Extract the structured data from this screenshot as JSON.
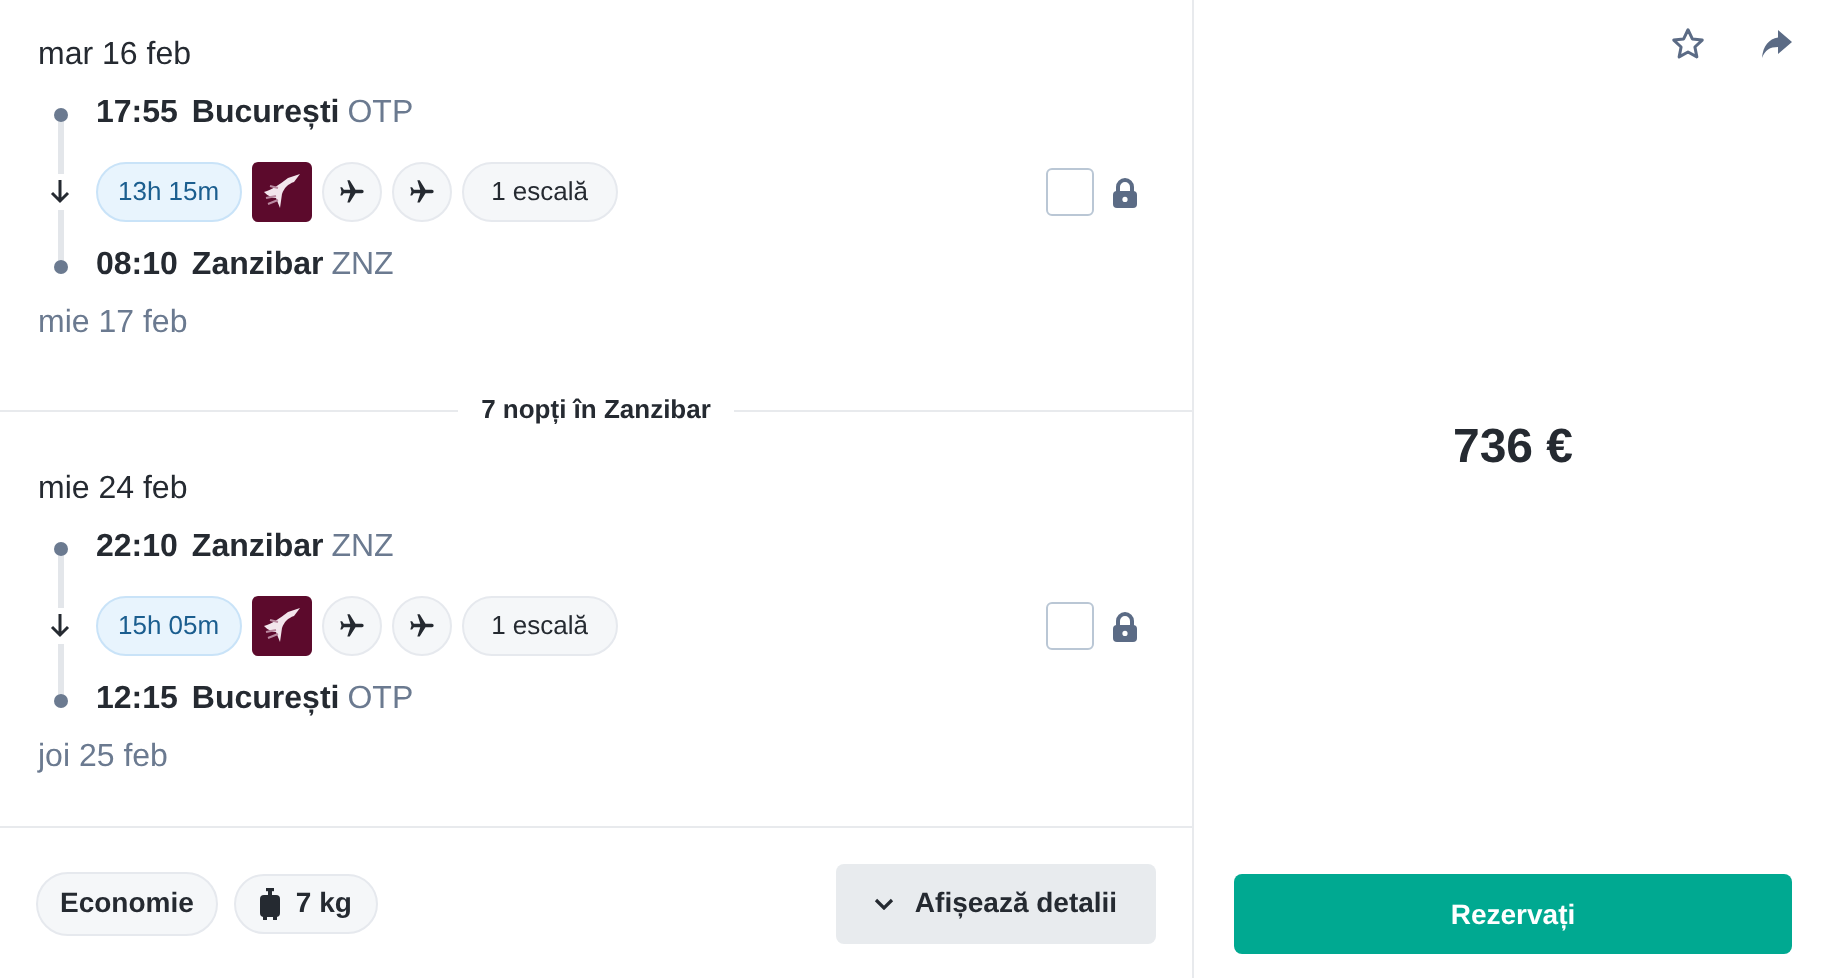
{
  "legs": [
    {
      "departure_date": "mar 16 feb",
      "departure": {
        "time": "17:55",
        "city": "București",
        "code": "OTP"
      },
      "duration": "13h 15m",
      "stops": "1 escală",
      "checked": false,
      "arrival": {
        "time": "08:10",
        "city": "Zanzibar",
        "code": "ZNZ"
      },
      "arrival_date": "mie 17 feb"
    },
    {
      "departure_date": "mie 24 feb",
      "departure": {
        "time": "22:10",
        "city": "Zanzibar",
        "code": "ZNZ"
      },
      "duration": "15h 05m",
      "stops": "1 escală",
      "checked": false,
      "arrival": {
        "time": "12:15",
        "city": "București",
        "code": "OTP"
      },
      "arrival_date": "joi 25 feb"
    }
  ],
  "stay": "7 nopți în Zanzibar",
  "fare_class": "Economie",
  "baggage": "7 kg",
  "details_button": "Afișează detalii",
  "price": "736 €",
  "book_button": "Rezervați"
}
